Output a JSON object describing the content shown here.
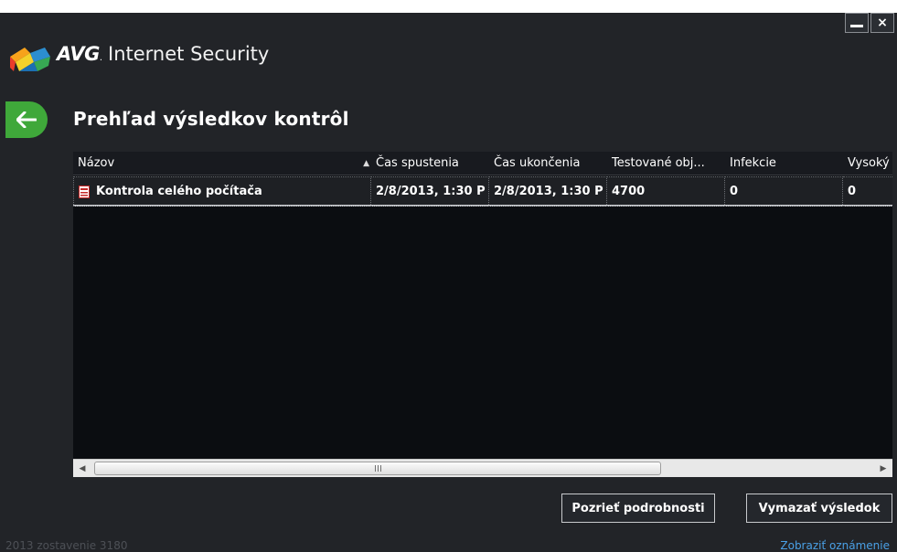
{
  "app": {
    "brand": "AVG",
    "product_name": "Internet Security",
    "window_controls": {
      "minimize": "—",
      "close": "×"
    }
  },
  "page": {
    "title": "Prehľad výsledkov kontrôl"
  },
  "table": {
    "columns": [
      {
        "label": "Názov",
        "sorted": true,
        "sort_direction": "ascending"
      },
      {
        "label": "Čas spustenia"
      },
      {
        "label": "Čas ukončenia"
      },
      {
        "label": "Testované obj..."
      },
      {
        "label": "Infekcie"
      },
      {
        "label": "Vysoký"
      }
    ],
    "rows": [
      {
        "name": "Kontrola celého počítača",
        "start_time": "2/8/2013, 1:30 P",
        "end_time": "2/8/2013, 1:30 P",
        "tested_objects": "4700",
        "infections": "0",
        "high": "0",
        "icon": "report-document-icon"
      }
    ]
  },
  "scrollbar": {
    "left_arrow": "◀",
    "right_arrow": "▶"
  },
  "buttons": {
    "details": "Pozrieť podrobnosti",
    "delete": "Vymazať výsledok"
  },
  "footer": {
    "build": "2013  zostavenie 3180",
    "notifications_link": "Zobraziť oznámenie"
  },
  "colors": {
    "background": "#222428",
    "table_background": "#0b0d11",
    "accent_green": "#3fa83a",
    "link_blue": "#4aa0e6"
  }
}
